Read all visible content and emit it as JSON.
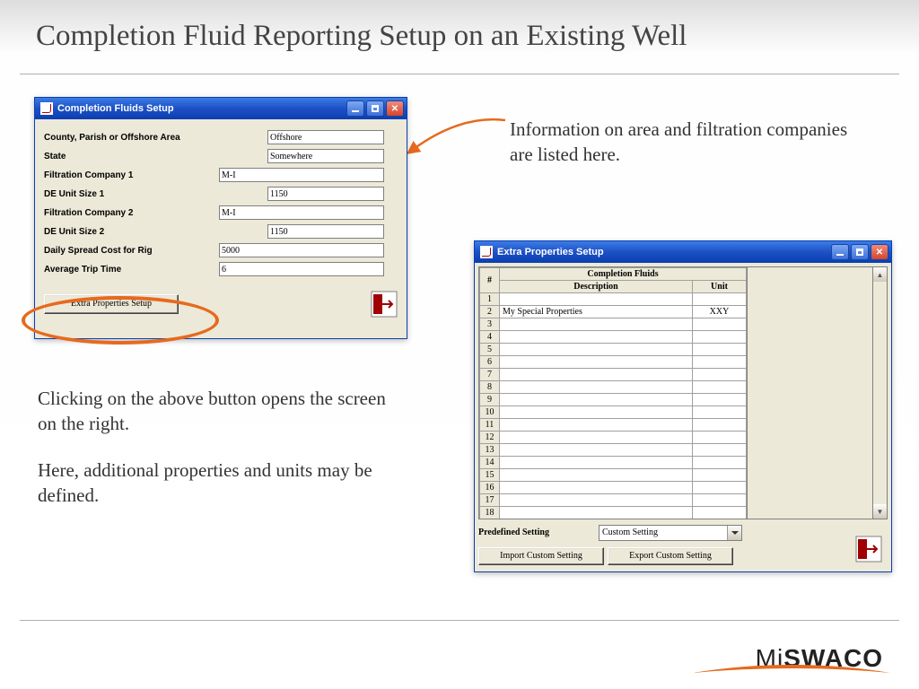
{
  "slide": {
    "title": "Completion Fluid Reporting Setup on an Existing Well"
  },
  "annotations": {
    "right": "Information on area and filtration companies are listed here.",
    "below1": "Clicking on the above button opens the screen on the right.",
    "below2": "Here, additional properties and units may be defined."
  },
  "win1": {
    "title": "Completion Fluids Setup",
    "fields": {
      "county_label": "County, Parish or Offshore Area",
      "county_value": "Offshore",
      "state_label": "State",
      "state_value": "Somewhere",
      "filt1_label": "Filtration Company 1",
      "filt1_value": "M-I",
      "de1_label": "DE Unit Size 1",
      "de1_value": "1150",
      "filt2_label": "Filtration Company 2",
      "filt2_value": "M-I",
      "de2_label": "DE Unit Size 2",
      "de2_value": "1150",
      "spread_label": "Daily Spread Cost for Rig",
      "spread_value": "5000",
      "trip_label": "Average Trip Time",
      "trip_value": "6"
    },
    "extra_btn": "Extra Properties Setup"
  },
  "win2": {
    "title": "Extra Properties Setup",
    "grid": {
      "col_hash": "#",
      "col_group": "Completion Fluids",
      "col_desc": "Description",
      "col_unit": "Unit",
      "rows": [
        {
          "n": "1",
          "desc": "",
          "unit": ""
        },
        {
          "n": "2",
          "desc": "My Special Properties",
          "unit": "XXY"
        },
        {
          "n": "3",
          "desc": "",
          "unit": ""
        },
        {
          "n": "4",
          "desc": "",
          "unit": ""
        },
        {
          "n": "5",
          "desc": "",
          "unit": ""
        },
        {
          "n": "6",
          "desc": "",
          "unit": ""
        },
        {
          "n": "7",
          "desc": "",
          "unit": ""
        },
        {
          "n": "8",
          "desc": "",
          "unit": ""
        },
        {
          "n": "9",
          "desc": "",
          "unit": ""
        },
        {
          "n": "10",
          "desc": "",
          "unit": ""
        },
        {
          "n": "11",
          "desc": "",
          "unit": ""
        },
        {
          "n": "12",
          "desc": "",
          "unit": ""
        },
        {
          "n": "13",
          "desc": "",
          "unit": ""
        },
        {
          "n": "14",
          "desc": "",
          "unit": ""
        },
        {
          "n": "15",
          "desc": "",
          "unit": ""
        },
        {
          "n": "16",
          "desc": "",
          "unit": ""
        },
        {
          "n": "17",
          "desc": "",
          "unit": ""
        },
        {
          "n": "18",
          "desc": "",
          "unit": ""
        }
      ]
    },
    "predefined_label": "Predefined Setting",
    "predefined_value": "Custom Setting",
    "import_btn": "Import Custom Setting",
    "export_btn": "Export Custom Setting"
  },
  "logo": {
    "part1": "Mi",
    "part2": "SWACO"
  }
}
